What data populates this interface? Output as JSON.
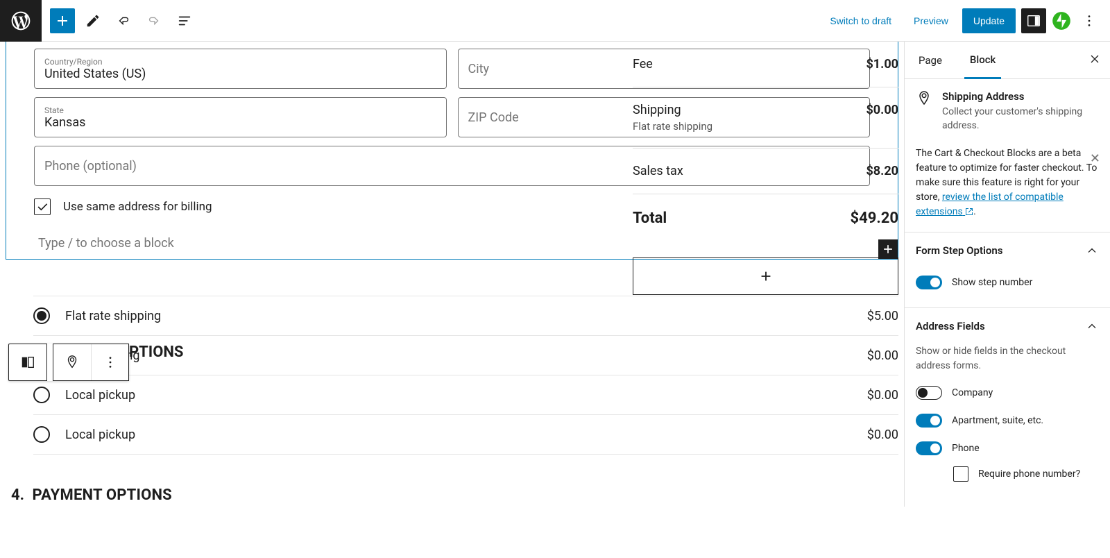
{
  "topbar": {
    "switch_draft": "Switch to draft",
    "preview": "Preview",
    "update": "Update"
  },
  "address_form": {
    "country_label": "Country/Region",
    "country_value": "United States (US)",
    "city_placeholder": "City",
    "state_label": "State",
    "state_value": "Kansas",
    "zip_placeholder": "ZIP Code",
    "phone_placeholder": "Phone (optional)",
    "same_address_label": "Use same address for billing",
    "block_prompt": "Type / to choose a block"
  },
  "shipping_options": {
    "title_partial": "PTIONS",
    "items": [
      {
        "label": "Flat rate shipping",
        "price": "$5.00",
        "selected": true
      },
      {
        "label": "Free shipping",
        "price": "$0.00",
        "selected": false
      },
      {
        "label": "Local pickup",
        "price": "$0.00",
        "selected": false
      },
      {
        "label": "Local pickup",
        "price": "$0.00",
        "selected": false
      }
    ]
  },
  "payment": {
    "number": "4.",
    "title": "PAYMENT OPTIONS"
  },
  "summary": {
    "fee_label": "Fee",
    "fee_value": "$1.00",
    "shipping_label": "Shipping",
    "shipping_sub": "Flat rate shipping",
    "shipping_value": "$0.00",
    "tax_label": "Sales tax",
    "tax_value": "$8.20",
    "total_label": "Total",
    "total_value": "$49.20"
  },
  "sidebar": {
    "tab_page": "Page",
    "tab_block": "Block",
    "block_title": "Shipping Address",
    "block_desc": "Collect your customer's shipping address.",
    "notice_text": "The Cart & Checkout Blocks are a beta feature to optimize for faster checkout. To make sure this feature is right for your store, ",
    "notice_link": "review the list of compatible extensions",
    "notice_suffix": ".",
    "panel_form_step": "Form Step Options",
    "show_step_number": "Show step number",
    "panel_address_fields": "Address Fields",
    "address_fields_help": "Show or hide fields in the checkout address forms.",
    "toggle_company": "Company",
    "toggle_apartment": "Apartment, suite, etc.",
    "toggle_phone": "Phone",
    "require_phone": "Require phone number?"
  }
}
